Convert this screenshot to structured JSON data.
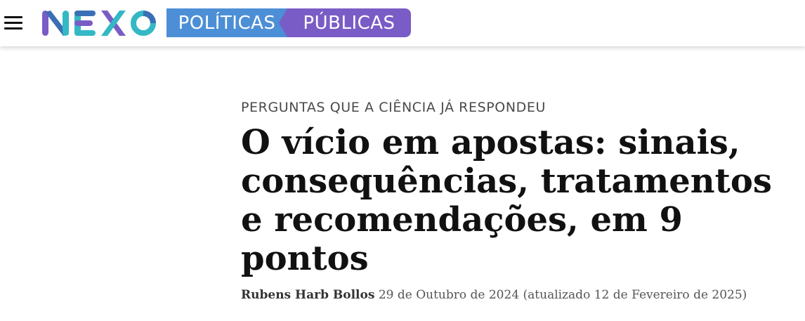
{
  "header": {
    "logo_text": "NEXO",
    "section_part1": "POLÍTICAS",
    "section_part2": "PÚBLICAS",
    "colors": {
      "section_blue": "#4c8fd6",
      "section_purple": "#7a5cc6",
      "logo_teal": "#34b8c4",
      "logo_blue": "#3a6fb5",
      "logo_purple": "#7a5cc6"
    }
  },
  "article": {
    "kicker": "PERGUNTAS QUE A CIÊNCIA JÁ RESPONDEU",
    "title": "O vício em apostas: sinais, consequências, tratamentos e recomendações, em 9 pontos",
    "author": "Rubens Harb Bollos",
    "date": "29 de Outubro de 2024 (atualizado 12 de Fevereiro de 2025)"
  }
}
